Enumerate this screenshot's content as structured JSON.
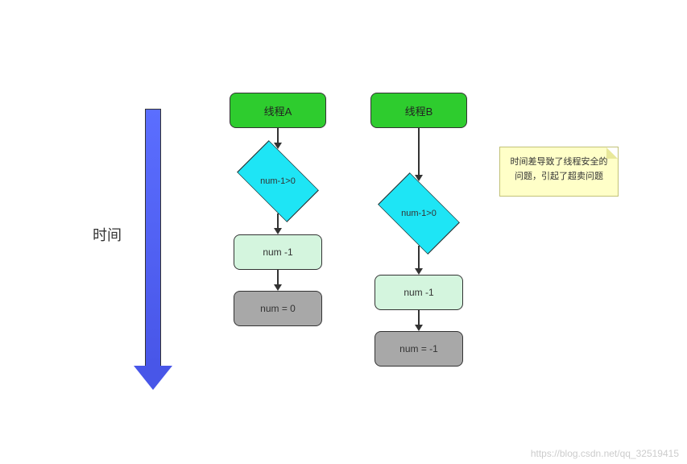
{
  "timeline": {
    "label": "时间"
  },
  "threadA": {
    "title": "线程A",
    "decision": "num-1>0",
    "process": "num -1",
    "result": "num = 0"
  },
  "threadB": {
    "title": "线程B",
    "decision": "num-1>0",
    "process": "num -1",
    "result": "num = -1"
  },
  "note": {
    "line1": "时间差导致了线程安全的",
    "line2": "问题，引起了超卖问题"
  },
  "watermark": "https://blog.csdn.net/qq_32519415",
  "colors": {
    "start": "#2ecc2e",
    "decision": "#1ee5f5",
    "process": "#d4f5de",
    "end": "#a8a8a8",
    "arrow": "#5b6eff",
    "note": "#ffffc8"
  }
}
